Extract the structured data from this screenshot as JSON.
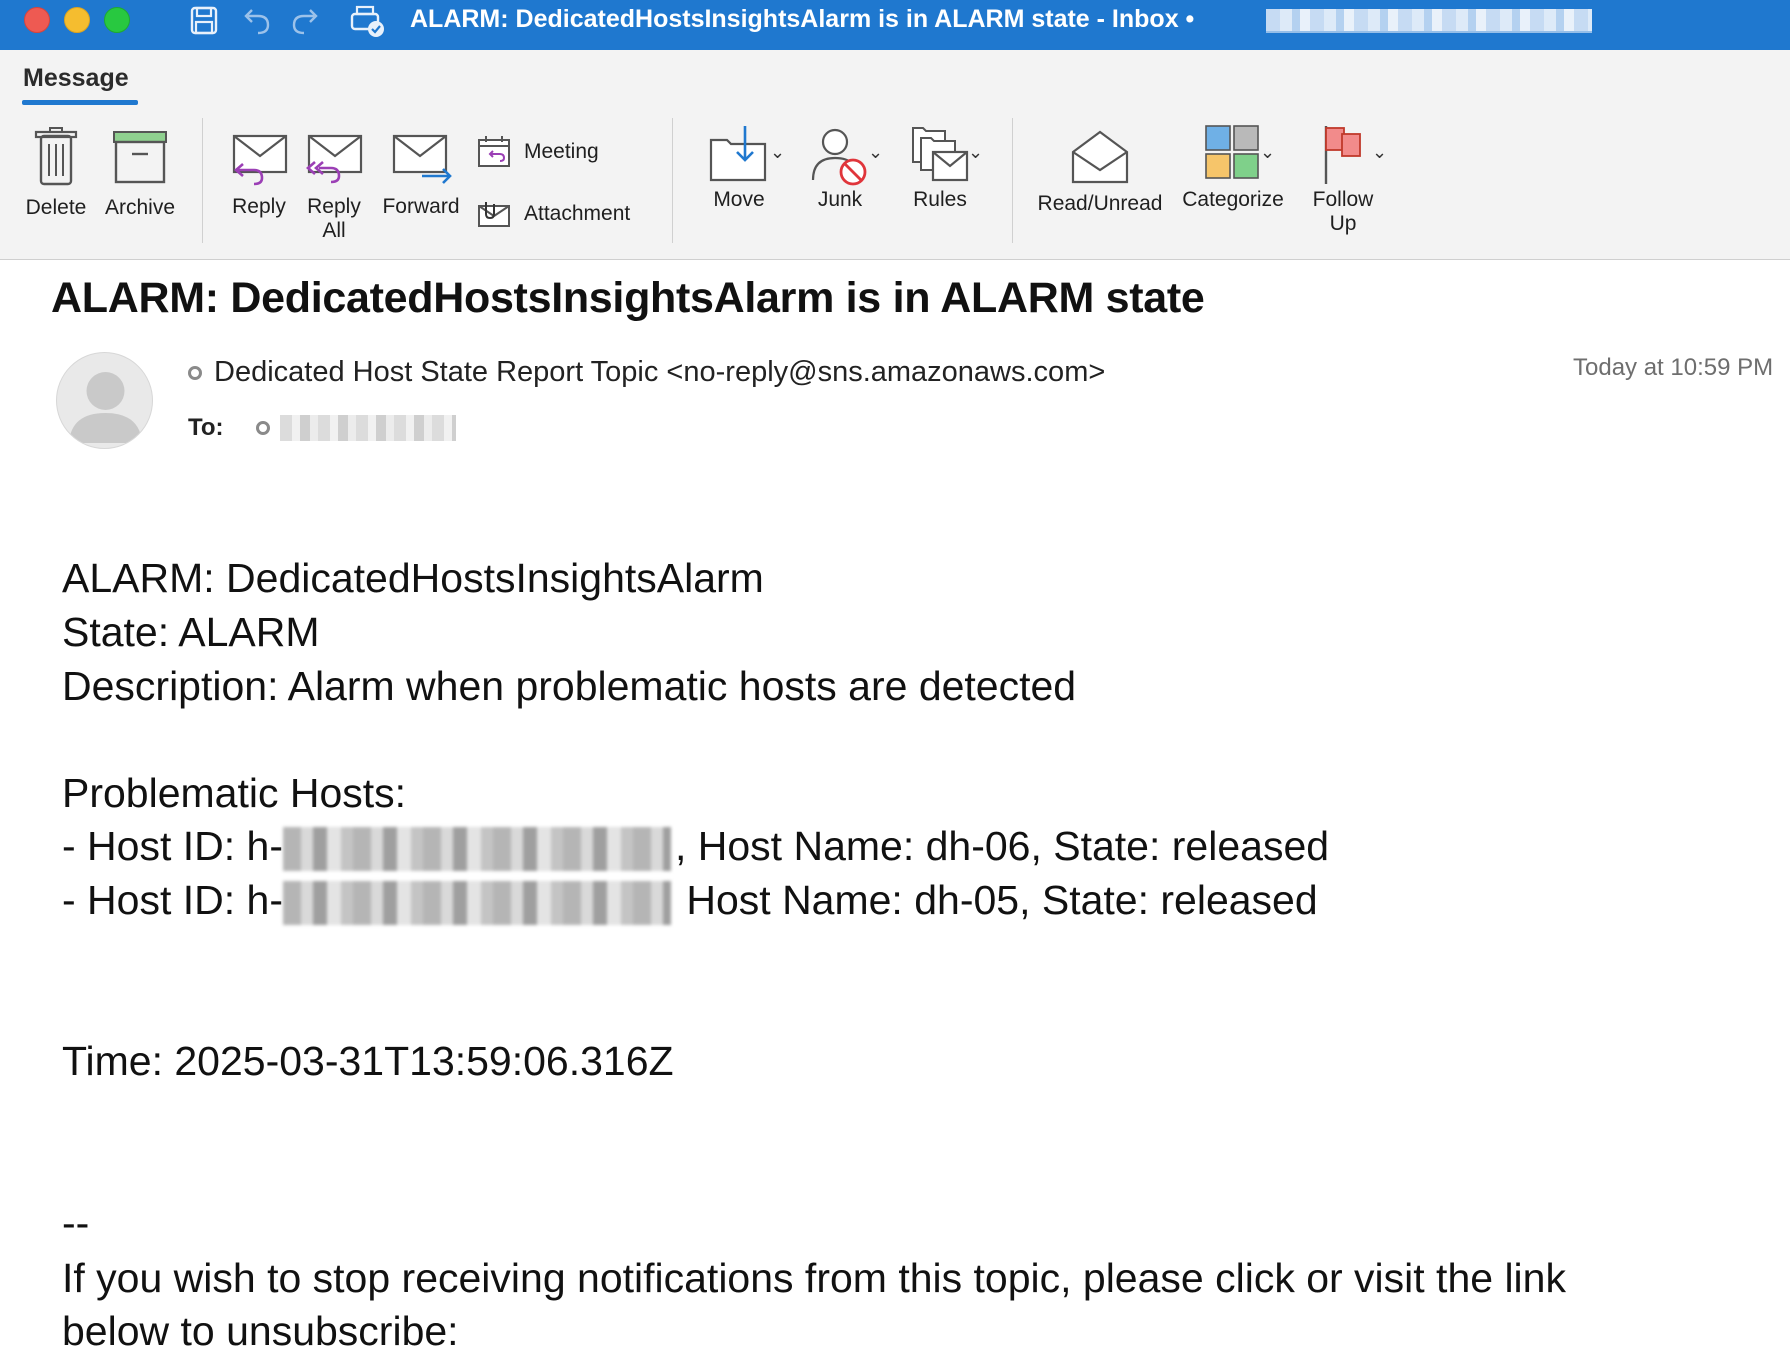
{
  "window": {
    "title": "ALARM: DedicatedHostsInsightsAlarm is in ALARM state - Inbox •"
  },
  "ribbon": {
    "tab": "Message",
    "buttons": {
      "delete": "Delete",
      "archive": "Archive",
      "reply": "Reply",
      "reply_all_1": "Reply",
      "reply_all_2": "All",
      "forward": "Forward",
      "meeting": "Meeting",
      "attachment": "Attachment",
      "move": "Move",
      "junk": "Junk",
      "rules": "Rules",
      "read_unread": "Read/Unread",
      "categorize": "Categorize",
      "follow_up_1": "Follow",
      "follow_up_2": "Up"
    }
  },
  "email": {
    "subject": "ALARM: DedicatedHostsInsightsAlarm is in ALARM state",
    "sender": "Dedicated Host State Report Topic <no-reply@sns.amazonaws.com>",
    "to_label": "To:",
    "timestamp": "Today at 10:59 PM",
    "body": {
      "line1": "ALARM: DedicatedHostsInsightsAlarm",
      "line2": "State: ALARM",
      "line3": "Description: Alarm when problematic hosts are detected",
      "line4": "Problematic Hosts:",
      "host1_prefix": "- Host ID: h-",
      "host1_suffix": ", Host Name: dh-06, State: released",
      "host2_prefix": "- Host ID: h-",
      "host2_suffix": " Host Name: dh-05, State: released",
      "time": "Time: 2025-03-31T13:59:06.316Z",
      "dashes": "--",
      "footer1": "If you wish to stop receiving notifications from this topic, please click or visit the link",
      "footer2": "below to unsubscribe:"
    }
  },
  "colors": {
    "titlebar": "#1f78cf",
    "accent": "#1f78cf"
  }
}
